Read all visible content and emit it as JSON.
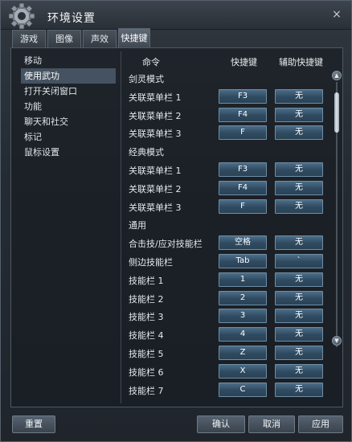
{
  "window": {
    "title": "环境设置",
    "close_glyph": "×",
    "icon": "gear-icon"
  },
  "tabs": [
    {
      "label": "游戏",
      "active": false
    },
    {
      "label": "图像",
      "active": false
    },
    {
      "label": "声效",
      "active": false
    },
    {
      "label": "快捷键",
      "active": true
    }
  ],
  "sidebar": {
    "items": [
      {
        "label": "移动",
        "selected": false
      },
      {
        "label": "使用武功",
        "selected": true
      },
      {
        "label": "打开关闭窗口",
        "selected": false
      },
      {
        "label": "功能",
        "selected": false
      },
      {
        "label": "聊天和社交",
        "selected": false
      },
      {
        "label": "标记",
        "selected": false
      },
      {
        "label": "鼠标设置",
        "selected": false
      }
    ]
  },
  "table": {
    "headers": {
      "command": "命令",
      "hotkey": "快捷键",
      "aux_hotkey": "辅助快捷键"
    },
    "rows": [
      {
        "type": "section",
        "label": "剑灵模式"
      },
      {
        "type": "binding",
        "label": "关联菜单栏 1",
        "key": "F3",
        "aux": "无"
      },
      {
        "type": "binding",
        "label": "关联菜单栏 2",
        "key": "F4",
        "aux": "无"
      },
      {
        "type": "binding",
        "label": "关联菜单栏 3",
        "key": "F",
        "aux": "无"
      },
      {
        "type": "section",
        "label": "经典模式"
      },
      {
        "type": "binding",
        "label": "关联菜单栏 1",
        "key": "F3",
        "aux": "无"
      },
      {
        "type": "binding",
        "label": "关联菜单栏 2",
        "key": "F4",
        "aux": "无"
      },
      {
        "type": "binding",
        "label": "关联菜单栏 3",
        "key": "F",
        "aux": "无"
      },
      {
        "type": "section",
        "label": "通用"
      },
      {
        "type": "binding",
        "label": "合击技/应对技能栏",
        "key": "空格",
        "aux": "无"
      },
      {
        "type": "binding",
        "label": "侧边技能栏",
        "key": "Tab",
        "aux": "`"
      },
      {
        "type": "binding",
        "label": "技能栏 1",
        "key": "1",
        "aux": "无"
      },
      {
        "type": "binding",
        "label": "技能栏 2",
        "key": "2",
        "aux": "无"
      },
      {
        "type": "binding",
        "label": "技能栏 3",
        "key": "3",
        "aux": "无"
      },
      {
        "type": "binding",
        "label": "技能栏 4",
        "key": "4",
        "aux": "无"
      },
      {
        "type": "binding",
        "label": "技能栏 5",
        "key": "Z",
        "aux": "无"
      },
      {
        "type": "binding",
        "label": "技能栏 6",
        "key": "X",
        "aux": "无"
      },
      {
        "type": "binding",
        "label": "技能栏 7",
        "key": "C",
        "aux": "无"
      }
    ]
  },
  "scroll": {
    "position": 0.05
  },
  "footer": {
    "reset": "重置",
    "ok": "确认",
    "cancel": "取消",
    "apply": "应用"
  },
  "colors": {
    "key_button": "#35536b",
    "selected_item": "#455261"
  }
}
